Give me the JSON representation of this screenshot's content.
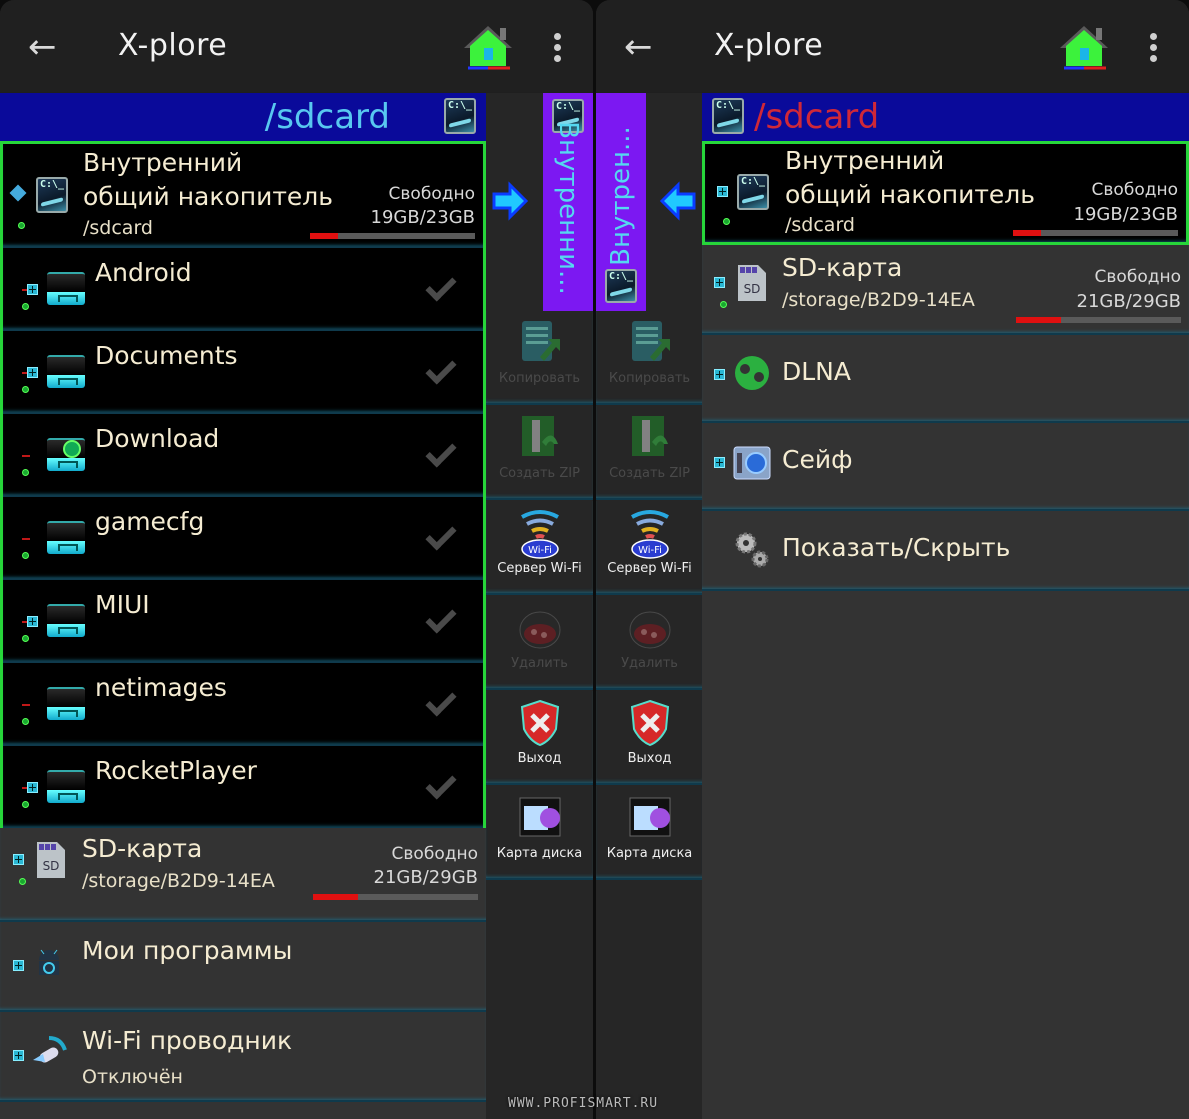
{
  "colors": {
    "selection_border": "#27d63a",
    "path_bar_bg": "#0a0a9a",
    "vertical_tab_bg": "#7c18f2",
    "vertical_tab_text": "#55d8f0",
    "path_left_text": "#58c8f0",
    "path_right_text": "#d02838",
    "usage_fill": "#e01010",
    "item_text": "#f5ecd2"
  },
  "left_phone": {
    "appbar": {
      "back_icon": "arrow-left-icon",
      "title": "X-plore",
      "home_icon": "home-icon",
      "menu_icon": "more-vert-icon"
    },
    "path": "/sdcard",
    "active_tree": {
      "root": {
        "name_line1": "Внутренний",
        "name_line2": "общий накопитель",
        "path": "/sdcard",
        "free_label": "Свободно",
        "free_value": "19GB/23GB",
        "used_fraction": 0.17
      },
      "folders": [
        {
          "name": "Android",
          "expandable": true,
          "icon": "folder-icon"
        },
        {
          "name": "Documents",
          "expandable": true,
          "icon": "folder-icon"
        },
        {
          "name": "Download",
          "expandable": false,
          "icon": "download-folder-icon"
        },
        {
          "name": "gamecfg",
          "expandable": false,
          "icon": "folder-icon"
        },
        {
          "name": "MIUI",
          "expandable": true,
          "icon": "folder-icon"
        },
        {
          "name": "netimages",
          "expandable": false,
          "icon": "folder-icon"
        },
        {
          "name": "RocketPlayer",
          "expandable": true,
          "icon": "folder-icon"
        }
      ]
    },
    "other_items": [
      {
        "name": "SD-карта",
        "sub": "/storage/B2D9-14EA",
        "free_label": "Свободно",
        "free_value": "21GB/29GB",
        "used_fraction": 0.27,
        "icon": "sd-card-icon"
      },
      {
        "name": "Мои программы",
        "sub": "",
        "icon": "android-apps-icon"
      },
      {
        "name": "Wi-Fi проводник",
        "sub": "Отключён",
        "icon": "wifi-explorer-icon"
      }
    ],
    "vertical_tab": {
      "label": "Внутренни..."
    },
    "toolbar": [
      {
        "label": "Копировать",
        "icon": "copy-icon",
        "enabled": false
      },
      {
        "label": "Создать ZIP",
        "icon": "zip-icon",
        "enabled": false
      },
      {
        "label": "Сервер Wi-Fi",
        "icon": "wifi-server-icon",
        "enabled": true
      },
      {
        "label": "Удалить",
        "icon": "delete-icon",
        "enabled": false
      },
      {
        "label": "Выход",
        "icon": "exit-icon",
        "enabled": true
      },
      {
        "label": "Карта диска",
        "icon": "disk-map-icon",
        "enabled": true
      }
    ]
  },
  "right_phone": {
    "appbar": {
      "back_icon": "arrow-left-icon",
      "title": "X-plore",
      "home_icon": "home-icon",
      "menu_icon": "more-vert-icon"
    },
    "path": "/sdcard",
    "vertical_tab": {
      "label": "Внутрен..."
    },
    "items": [
      {
        "name_line1": "Внутренний",
        "name_line2": "общий накопитель",
        "sub": "/sdcard",
        "free_label": "Свободно",
        "free_value": "19GB/23GB",
        "used_fraction": 0.17,
        "selected": true,
        "icon": "internal-storage-icon"
      },
      {
        "name": "SD-карта",
        "sub": "/storage/B2D9-14EA",
        "free_label": "Свободно",
        "free_value": "21GB/29GB",
        "used_fraction": 0.27,
        "icon": "sd-card-icon"
      },
      {
        "name": "DLNA",
        "icon": "dlna-icon"
      },
      {
        "name": "Сейф",
        "icon": "vault-icon"
      },
      {
        "name": "Показать/Скрыть",
        "icon": "gears-icon"
      }
    ],
    "toolbar": [
      {
        "label": "Копировать",
        "icon": "copy-icon",
        "enabled": false
      },
      {
        "label": "Создать ZIP",
        "icon": "zip-icon",
        "enabled": false
      },
      {
        "label": "Сервер Wi-Fi",
        "icon": "wifi-server-icon",
        "enabled": true
      },
      {
        "label": "Удалить",
        "icon": "delete-icon",
        "enabled": false
      },
      {
        "label": "Выход",
        "icon": "exit-icon",
        "enabled": true
      },
      {
        "label": "Карта диска",
        "icon": "disk-map-icon",
        "enabled": true
      }
    ]
  },
  "watermark": "WWW.PROFISMART.RU"
}
